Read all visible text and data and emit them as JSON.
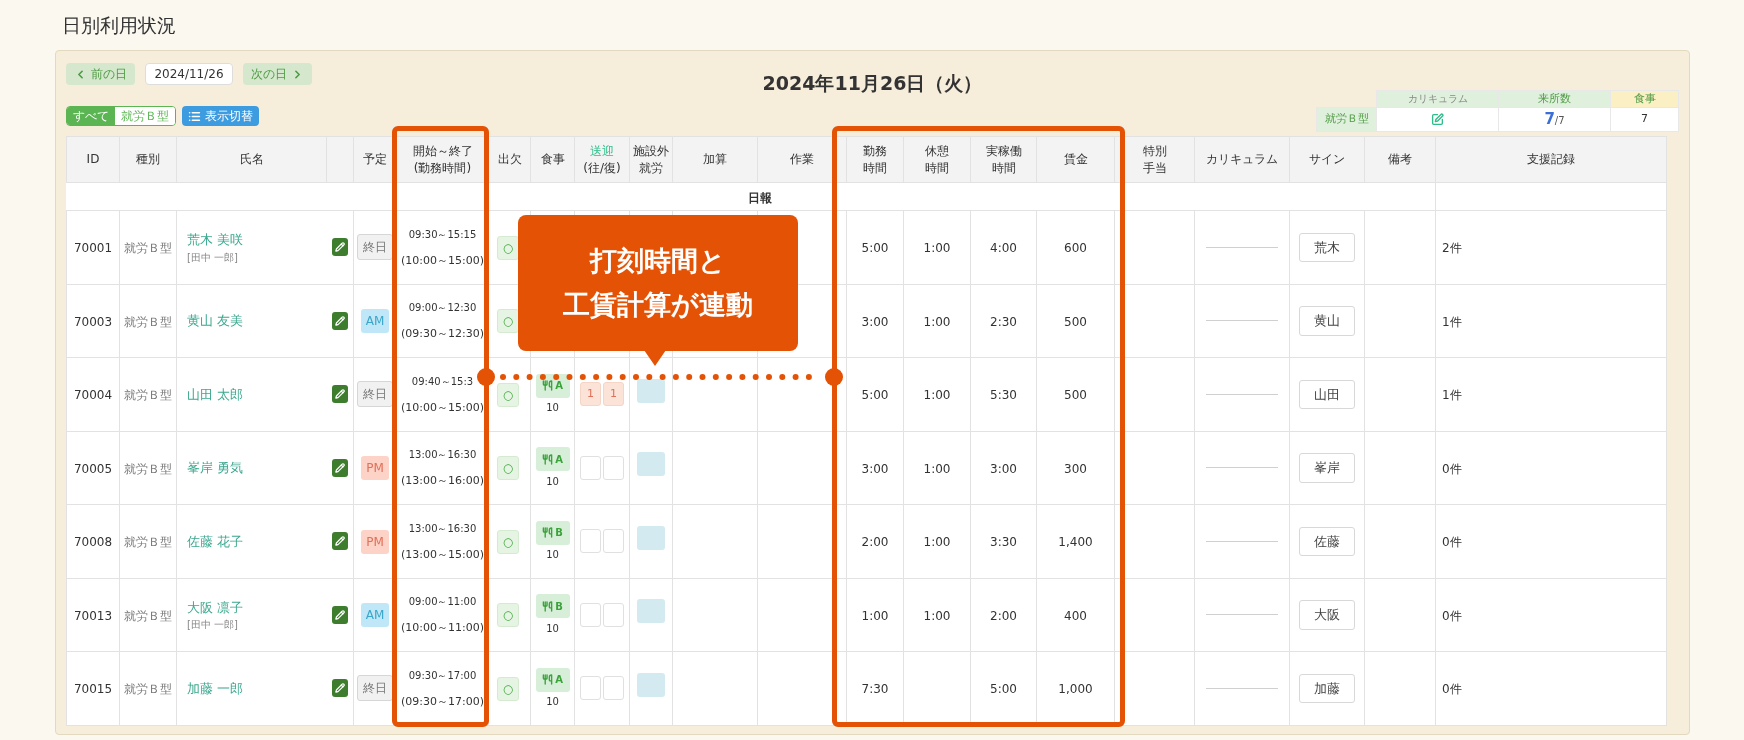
{
  "page_title": "日別利用状況",
  "nav": {
    "prev": "前の日",
    "date": "2024/11/26",
    "next": "次の日"
  },
  "date_heading": "2024年11月26日（火）",
  "filters": [
    {
      "label": "すべて",
      "selected": true
    },
    {
      "label": "就労Ｂ型",
      "selected": false
    }
  ],
  "view_toggle": "表示切替",
  "summary": {
    "columns": [
      "カリキュラム",
      "来所数",
      "食事"
    ],
    "row_label": "就労Ｂ型",
    "visits": "7",
    "visits_total": "/7",
    "meals": "7"
  },
  "columns": [
    {
      "lines": [
        "ID"
      ]
    },
    {
      "lines": [
        "種別"
      ]
    },
    {
      "lines": [
        "氏名"
      ]
    },
    {
      "lines": [
        "予定"
      ]
    },
    {
      "lines": [
        "開始～終了",
        "(勤務時間)"
      ]
    },
    {
      "lines": [
        "出欠"
      ]
    },
    {
      "lines": [
        "食事"
      ]
    },
    {
      "lines": [
        "送迎",
        "(往/復)"
      ],
      "link": true
    },
    {
      "lines": [
        "施設外",
        "就労"
      ]
    },
    {
      "lines": [
        "加算"
      ]
    },
    {
      "lines": [
        "作業"
      ]
    },
    {
      "lines": [
        "勤務",
        "時間"
      ]
    },
    {
      "lines": [
        "休憩",
        "時間"
      ]
    },
    {
      "lines": [
        "実稼働",
        "時間"
      ]
    },
    {
      "lines": [
        "賃金"
      ]
    },
    {
      "lines": [
        "特別",
        "手当"
      ]
    },
    {
      "lines": [
        "カリキュラム"
      ]
    },
    {
      "lines": [
        "サイン"
      ]
    },
    {
      "lines": [
        "備考"
      ]
    },
    {
      "lines": [
        "支援記録"
      ]
    }
  ],
  "report_label": "日報",
  "rows": [
    {
      "id": "70001",
      "type": "就労Ｂ型",
      "name": "荒木 美咲",
      "note": "[田中 一郎]",
      "schedule": {
        "label": "終日",
        "kind": "allday"
      },
      "time": "09:30～15:15",
      "planned": "(10:00～15:00)",
      "attendance": "○",
      "work": "5:00",
      "break": "1:00",
      "actual": "4:00",
      "wage": "600",
      "sign": "荒木",
      "support": "2件"
    },
    {
      "id": "70003",
      "type": "就労Ｂ型",
      "name": "黄山 友美",
      "schedule": {
        "label": "AM",
        "kind": "am"
      },
      "time": "09:00～12:30",
      "planned": "(09:30～12:30)",
      "attendance": "○",
      "work": "3:00",
      "break": "1:00",
      "actual": "2:30",
      "wage": "500",
      "sign": "黄山",
      "support": "1件"
    },
    {
      "id": "70004",
      "type": "就労Ｂ型",
      "name": "山田 太郎",
      "schedule": {
        "label": "終日",
        "kind": "allday"
      },
      "time": "09:40～15:3",
      "planned": "(10:00～15:00)",
      "attendance": "○",
      "meal": {
        "label": "A",
        "count": "10"
      },
      "transport": [
        {
          "filled": true,
          "label": "1"
        },
        {
          "filled": true,
          "label": "1"
        }
      ],
      "offsite": true,
      "work": "5:00",
      "break": "1:00",
      "actual": "5:30",
      "wage": "500",
      "sign": "山田",
      "support": "1件"
    },
    {
      "id": "70005",
      "type": "就労Ｂ型",
      "name": "峯岸 勇気",
      "schedule": {
        "label": "PM",
        "kind": "pm"
      },
      "time": "13:00～16:30",
      "planned": "(13:00～16:00)",
      "attendance": "○",
      "meal": {
        "label": "A",
        "count": "10"
      },
      "transport": [
        {
          "filled": false
        },
        {
          "filled": false
        }
      ],
      "offsite": true,
      "work": "3:00",
      "break": "1:00",
      "actual": "3:00",
      "wage": "300",
      "sign": "峯岸",
      "support": "0件"
    },
    {
      "id": "70008",
      "type": "就労Ｂ型",
      "name": "佐藤 花子",
      "schedule": {
        "label": "PM",
        "kind": "pm"
      },
      "time": "13:00～16:30",
      "planned": "(13:00～15:00)",
      "attendance": "○",
      "meal": {
        "label": "B",
        "count": "10"
      },
      "transport": [
        {
          "filled": false
        },
        {
          "filled": false
        }
      ],
      "offsite": true,
      "work": "2:00",
      "break": "1:00",
      "actual": "3:30",
      "wage": "1,400",
      "sign": "佐藤",
      "support": "0件"
    },
    {
      "id": "70013",
      "type": "就労Ｂ型",
      "name": "大阪 凛子",
      "note": "[田中 一郎]",
      "schedule": {
        "label": "AM",
        "kind": "am"
      },
      "time": "09:00～11:00",
      "planned": "(10:00～11:00)",
      "attendance": "○",
      "meal": {
        "label": "B",
        "count": "10"
      },
      "transport": [
        {
          "filled": false
        },
        {
          "filled": false
        }
      ],
      "offsite": true,
      "work": "1:00",
      "break": "1:00",
      "actual": "2:00",
      "wage": "400",
      "sign": "大阪",
      "support": "0件"
    },
    {
      "id": "70015",
      "type": "就労Ｂ型",
      "name": "加藤 一郎",
      "schedule": {
        "label": "終日",
        "kind": "allday"
      },
      "time": "09:30～17:00",
      "planned": "(09:30～17:00)",
      "attendance": "○",
      "meal": {
        "label": "A",
        "count": "10"
      },
      "transport": [
        {
          "filled": false
        },
        {
          "filled": false
        }
      ],
      "offsite": true,
      "work": "7:30",
      "actual": "5:00",
      "wage": "1,000",
      "sign": "加藤",
      "support": "0件"
    }
  ],
  "callout": [
    "打刻時間と",
    "工賃計算が連動"
  ]
}
